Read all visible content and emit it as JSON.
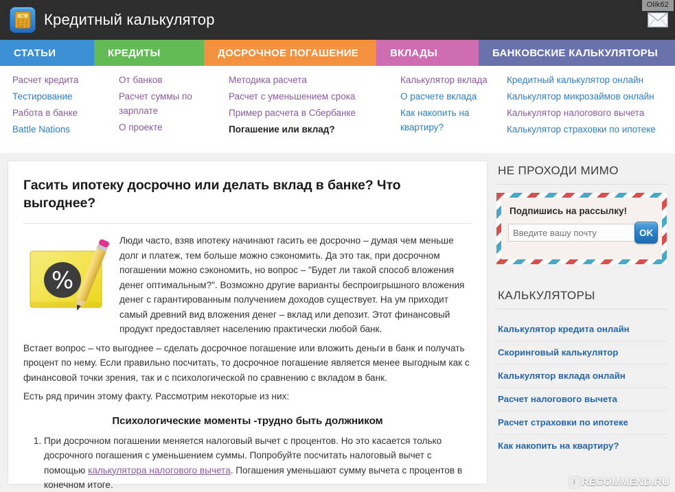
{
  "header": {
    "title": "Кредитный калькулятор",
    "logo_icon": "calculator-icon",
    "user_name": "Olik62",
    "mail_icon": "envelope-icon"
  },
  "nav": {
    "items": [
      {
        "label": "СТАТЬИ",
        "color": "#3b8fd4"
      },
      {
        "label": "КРЕДИТЫ",
        "color": "#63bb56"
      },
      {
        "label": "ДОСРОЧНОЕ ПОГАШЕНИЕ",
        "color": "#f4913f"
      },
      {
        "label": "ВКЛАДЫ",
        "color": "#cd6cb0"
      },
      {
        "label": "БАНКОВСКИЕ КАЛЬКУЛЯТОРЫ",
        "color": "#6a72ab"
      }
    ]
  },
  "subnav": {
    "columns": [
      {
        "links": [
          {
            "label": "Расчет кредита",
            "state": "visited"
          },
          {
            "label": "Тестирование",
            "state": "normal"
          },
          {
            "label": "Работа в банке",
            "state": "visited"
          },
          {
            "label": "Battle Nations",
            "state": "normal"
          }
        ]
      },
      {
        "links": [
          {
            "label": "От банков",
            "state": "visited"
          },
          {
            "label": "Расчет суммы по зарплате",
            "state": "visited"
          },
          {
            "label": "О проекте",
            "state": "visited"
          }
        ]
      },
      {
        "links": [
          {
            "label": "Методика расчета",
            "state": "visited"
          },
          {
            "label": "Расчет с уменьшением срока",
            "state": "visited"
          },
          {
            "label": "Пример расчета в Сбербанке",
            "state": "visited"
          },
          {
            "label": "Погашение или вклад?",
            "state": "current"
          }
        ]
      },
      {
        "links": [
          {
            "label": "Калькулятор вклада",
            "state": "visited"
          },
          {
            "label": "О расчете вклада",
            "state": "normal"
          },
          {
            "label": "Как накопить на квартиру?",
            "state": "normal"
          }
        ]
      },
      {
        "links": [
          {
            "label": "Кредитный калькулятор онлайн",
            "state": "normal"
          },
          {
            "label": "Калькулятор микрозаймов онлайн",
            "state": "normal"
          },
          {
            "label": "Калькулятор налогового вычета",
            "state": "visited"
          },
          {
            "label": "Калькулятор страховки по ипотеке",
            "state": "normal"
          }
        ]
      }
    ]
  },
  "article": {
    "title": "Гасить ипотеку досрочно или делать вклад в банке? Что выгоднее?",
    "illustration": "yellow-note-percent-pencil-illustration",
    "intro": "Люди часто, взяв ипотеку начинают гасить ее досрочно – думая чем меньше долг и платеж, тем больше можно сэкономить. Да это так, при досрочном погашении можно сэкономить, но вопрос – \"Будет ли такой способ вложения денег оптимальным?\". Возможно другие варианты беспроигрышного вложения денег с гарантированным получением доходов существует. На ум приходит самый древний вид вложения денег – вклад или депозит. Этот финансовый продукт предоставляет населению практически любой банк.",
    "paragraph_2": "Встает вопрос – что выгоднее – сделать досрочное погашение или вложить деньги в банк и получать процент по нему. Если правильно посчитать, то досрочное погашение является менее выгодным как с финансовой точки зрения, так и с психологической по сравнению с вкладом в банк.",
    "paragraph_3": "Есть ряд причин этому факту. Рассмотрим некоторые из них:",
    "subheading": "Психологические моменты -трудно быть должником",
    "list_item_1_part1": "При досрочном погашении меняется налоговый вычет с процентов. Но это касается только досрочного погашения с уменьшением суммы. Попробуйте посчитать налоговый вычет с помощью ",
    "list_item_1_link": "калькулятора налогового вычета",
    "list_item_1_part2": ". Погашения уменьшают сумму вычета с процентов в конечном итоге."
  },
  "sidebar": {
    "promo": {
      "title": "НЕ ПРОХОДИ МИМО",
      "newsletter_title": "Подпишись на рассылку!",
      "email_placeholder": "Введите вашу почту",
      "email_value": "",
      "submit_label": "OK"
    },
    "calculators": {
      "title": "КАЛЬКУЛЯТОРЫ",
      "links": [
        "Калькулятор кредита онлайн",
        "Скоринговый калькулятор",
        "Калькулятор вклада онлайн",
        "Расчет налогового вычета",
        "Расчет страховки по ипотеке",
        "Как накопить на квартиру?"
      ]
    }
  },
  "watermark": {
    "badge": "i",
    "text": "RECOMMEND.RU"
  }
}
